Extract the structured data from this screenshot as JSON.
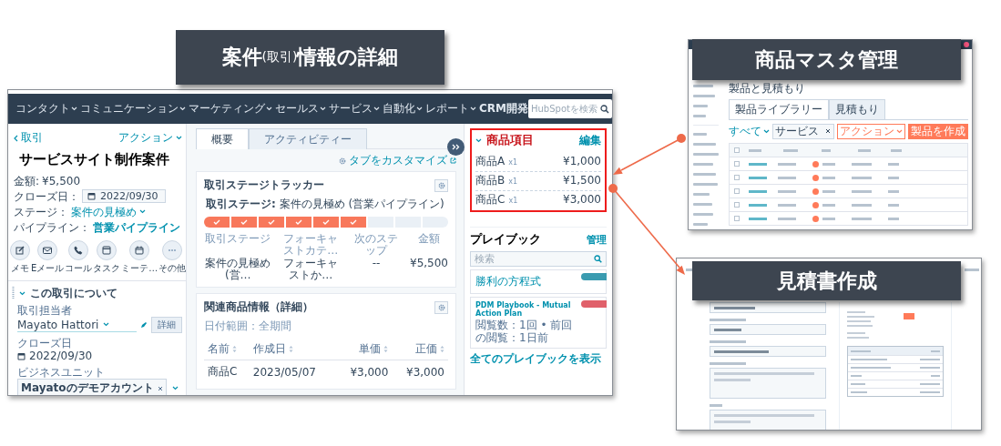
{
  "captions": [
    {
      "parts": [
        {
          "text": "案件",
          "small": false
        },
        {
          "text": "(取引)",
          "small": true
        },
        {
          "text": "情報の詳細",
          "small": false
        }
      ]
    },
    {
      "parts": [
        {
          "text": "商品マスタ管理",
          "small": false
        }
      ]
    },
    {
      "parts": [
        {
          "text": "見積書作成",
          "small": false
        }
      ]
    }
  ],
  "deal_screen": {
    "nav": [
      {
        "label": "コンタクト",
        "dropdown": true
      },
      {
        "label": "コミュニケーション",
        "dropdown": true
      },
      {
        "label": "マーケティング",
        "dropdown": true
      },
      {
        "label": "セールス",
        "dropdown": true
      },
      {
        "label": "サービス",
        "dropdown": true
      },
      {
        "label": "自動化",
        "dropdown": true
      },
      {
        "label": "レポート",
        "dropdown": true
      },
      {
        "label": "CRM開発",
        "dropdown": false
      }
    ],
    "search": {
      "placeholder": "HubSpotを検索"
    },
    "record": {
      "back": "取引",
      "actions": "アクション",
      "title": "サービスサイト制作案件",
      "fields": [
        {
          "kind": "text",
          "label": "金額:",
          "value": "¥5,500"
        },
        {
          "kind": "date",
          "label": "クローズ日：",
          "value": "2022/09/30"
        },
        {
          "kind": "dropdown",
          "label": "ステージ：",
          "value": "案件の見極め"
        },
        {
          "kind": "link",
          "label": "パイプライン：",
          "value": "営業パイプライン"
        }
      ],
      "quick_actions": [
        {
          "kind": "note",
          "label": "メモ"
        },
        {
          "kind": "email",
          "label": "Eメール"
        },
        {
          "kind": "call",
          "label": "コール"
        },
        {
          "kind": "task",
          "label": "タスク"
        },
        {
          "kind": "meeting",
          "label": "ミーテ…"
        },
        {
          "kind": "more",
          "label": "その他"
        }
      ]
    },
    "about": {
      "title": "この取引について",
      "expanded": true,
      "owner_label": "取引担当者",
      "owner": "Mayato Hattori",
      "details_button": "詳細",
      "close_label": "クローズ日",
      "close_date": "2022/09/30",
      "unit_label": "ビジネスユニット",
      "unit_tag": "Mayatoのデモアカウント"
    },
    "tabs": [
      {
        "label": "概要",
        "selected": true
      },
      {
        "label": "アクティビティー",
        "selected": false
      }
    ],
    "customize_link": "タブをカスタマイズ",
    "tracker": {
      "title": "取引ステージトラッカー",
      "stage_line": "**取引ステージ:** 案件の見極め (営業パイプライン)",
      "steps": [
        {
          "done": true
        },
        {
          "done": true
        },
        {
          "done": true
        },
        {
          "done": true
        },
        {
          "done": true
        },
        {
          "done": true
        },
        {
          "done": false
        },
        {
          "done": false
        },
        {
          "done": false
        }
      ],
      "columns": [
        {
          "label": "取引ステージ",
          "value": "案件の見極め (営…"
        },
        {
          "label": "フォーキャストカテ…",
          "value": "フォーキャストか…"
        },
        {
          "label": "次のステップ",
          "value": "--"
        },
        {
          "label": "金額",
          "value": "¥5,500"
        }
      ]
    },
    "products": {
      "title": "関連商品情報（詳細）",
      "date_range": "日付範囲：全期間",
      "columns": [
        "名前",
        "作成日",
        "単価",
        "正価"
      ],
      "rows": [
        [
          "商品C",
          "2023/05/07",
          "¥3,000",
          "¥3,000"
        ]
      ]
    },
    "line_items": {
      "title": "商品項目",
      "highlighted": true,
      "edit": "編集",
      "items": [
        {
          "name": "商品A",
          "qty": "x1",
          "price": "¥1,000"
        },
        {
          "name": "商品B",
          "qty": "x1",
          "price": "¥1,500"
        },
        {
          "name": "商品C",
          "qty": "x1",
          "price": "¥3,000"
        }
      ]
    },
    "playbooks": {
      "title": "プレイブック",
      "manage": "管理",
      "search": {
        "placeholder": "検索"
      },
      "cards": [
        {
          "title": "勝利の方程式",
          "color": "#3a9bb0"
        },
        {
          "title": "PDM Playbook - Mutual Action Plan",
          "meta": "閲覧数：1回 • 前回の閲覧：1日前",
          "color": "#e0606a"
        }
      ],
      "view_all": "全てのプレイブックを表示"
    }
  },
  "master_screen": {
    "heading": "製品と見積もり",
    "tabs": [
      {
        "label": "製品ライブラリー",
        "selected": true
      },
      {
        "label": "見積もり",
        "selected": false
      }
    ],
    "filter": "すべて",
    "search": {
      "value": "サービス"
    },
    "buttons": [
      {
        "kind": "secondary",
        "label": "アクション"
      },
      {
        "kind": "primary",
        "label": "製品を作成"
      }
    ]
  }
}
